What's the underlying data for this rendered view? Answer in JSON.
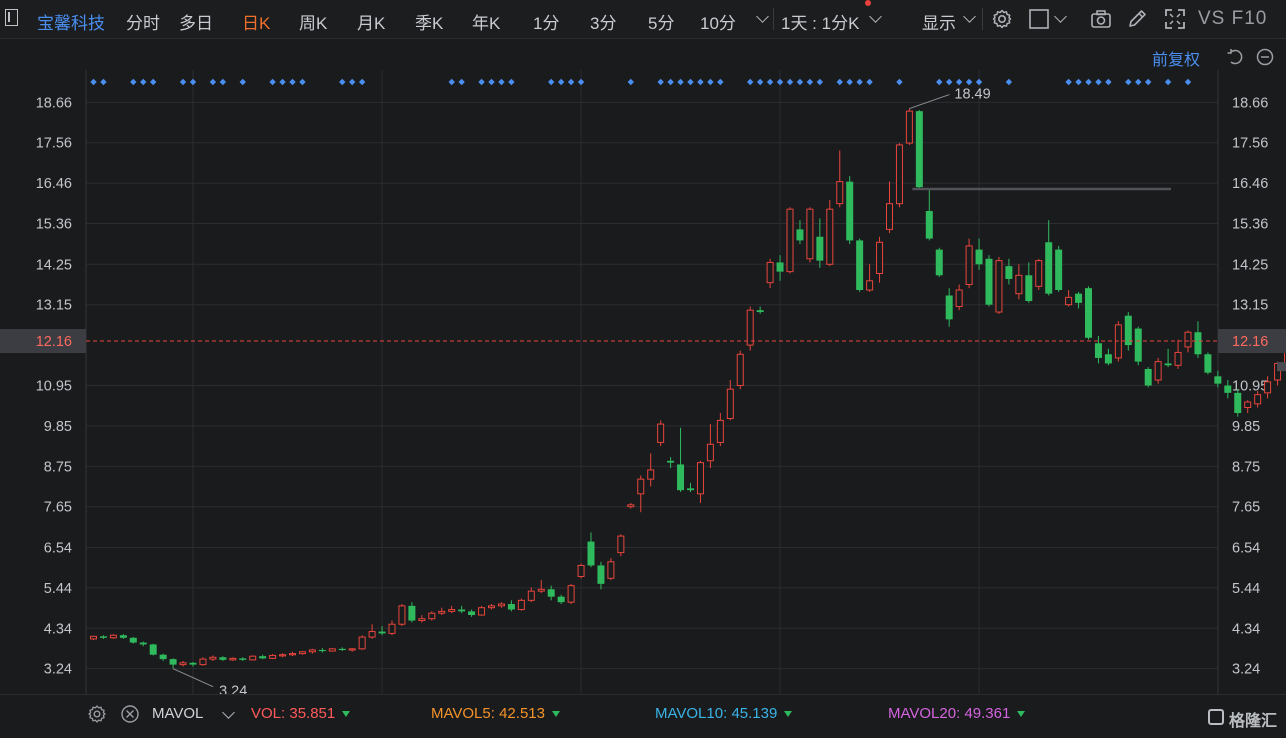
{
  "toolbar": {
    "stock_name": "宝馨科技",
    "periods": [
      {
        "label": "分时",
        "active": false
      },
      {
        "label": "多日",
        "active": false
      },
      {
        "label": "日K",
        "active": true
      },
      {
        "label": "周K",
        "active": false
      },
      {
        "label": "月K",
        "active": false
      },
      {
        "label": "季K",
        "active": false
      },
      {
        "label": "年K",
        "active": false
      },
      {
        "label": "1分",
        "active": false
      },
      {
        "label": "3分",
        "active": false
      },
      {
        "label": "5分",
        "active": false
      },
      {
        "label": "10分",
        "active": false
      }
    ],
    "multi_period": "1天 : 1分K",
    "display": "显示",
    "vs_f10": "VS F10"
  },
  "adjust": "前复权",
  "colors": {
    "up": "#e8453c",
    "down": "#2fba5d",
    "accent": "#f0702c",
    "link": "#4a8ff0",
    "grid": "#2c2d31",
    "marker": "#4a8ff0"
  },
  "chart_data": {
    "type": "candlestick",
    "y_ticks": [
      "18.66",
      "17.56",
      "16.46",
      "15.36",
      "14.25",
      "13.15",
      "12.16",
      "10.95",
      "9.85",
      "8.75",
      "7.65",
      "6.54",
      "5.44",
      "4.34",
      "3.24"
    ],
    "ylim": [
      2.55,
      19.54
    ],
    "current_price": "12.16",
    "high_label": "18.49",
    "low_label": "3.24",
    "resistance_level": 16.3,
    "candles": [
      [
        4.05,
        4.12,
        4.02,
        4.13
      ],
      [
        4.12,
        4.08,
        4.05,
        4.15
      ],
      [
        4.08,
        4.15,
        4.05,
        4.18
      ],
      [
        4.15,
        4.08,
        4.05,
        4.18
      ],
      [
        4.08,
        3.95,
        3.92,
        4.1
      ],
      [
        3.95,
        3.9,
        3.85,
        3.98
      ],
      [
        3.9,
        3.62,
        3.6,
        3.92
      ],
      [
        3.62,
        3.5,
        3.45,
        3.65
      ],
      [
        3.5,
        3.35,
        3.24,
        3.52
      ],
      [
        3.35,
        3.4,
        3.3,
        3.45
      ],
      [
        3.4,
        3.35,
        3.3,
        3.42
      ],
      [
        3.35,
        3.5,
        3.32,
        3.55
      ],
      [
        3.5,
        3.55,
        3.45,
        3.6
      ],
      [
        3.55,
        3.48,
        3.45,
        3.58
      ],
      [
        3.48,
        3.52,
        3.45,
        3.55
      ],
      [
        3.52,
        3.48,
        3.45,
        3.55
      ],
      [
        3.48,
        3.58,
        3.46,
        3.6
      ],
      [
        3.58,
        3.52,
        3.5,
        3.62
      ],
      [
        3.52,
        3.6,
        3.5,
        3.64
      ],
      [
        3.6,
        3.62,
        3.55,
        3.66
      ],
      [
        3.62,
        3.65,
        3.58,
        3.7
      ],
      [
        3.65,
        3.7,
        3.62,
        3.72
      ],
      [
        3.7,
        3.75,
        3.65,
        3.78
      ],
      [
        3.75,
        3.72,
        3.68,
        3.8
      ],
      [
        3.72,
        3.78,
        3.7,
        3.8
      ],
      [
        3.78,
        3.75,
        3.72,
        3.82
      ],
      [
        3.75,
        3.78,
        3.7,
        3.8
      ],
      [
        3.78,
        4.1,
        3.75,
        4.15
      ],
      [
        4.1,
        4.25,
        4.05,
        4.45
      ],
      [
        4.25,
        4.2,
        4.15,
        4.4
      ],
      [
        4.2,
        4.45,
        4.15,
        4.55
      ],
      [
        4.45,
        4.95,
        4.4,
        5.0
      ],
      [
        4.95,
        4.55,
        4.5,
        5.05
      ],
      [
        4.55,
        4.6,
        4.5,
        4.7
      ],
      [
        4.6,
        4.75,
        4.55,
        4.8
      ],
      [
        4.75,
        4.8,
        4.7,
        4.9
      ],
      [
        4.8,
        4.85,
        4.75,
        4.95
      ],
      [
        4.85,
        4.8,
        4.75,
        4.95
      ],
      [
        4.8,
        4.7,
        4.65,
        4.85
      ],
      [
        4.7,
        4.9,
        4.68,
        4.95
      ],
      [
        4.9,
        4.95,
        4.85,
        5.0
      ],
      [
        4.95,
        5.0,
        4.9,
        5.05
      ],
      [
        5.0,
        4.85,
        4.8,
        5.1
      ],
      [
        4.85,
        5.1,
        4.82,
        5.15
      ],
      [
        5.1,
        5.35,
        5.05,
        5.45
      ],
      [
        5.35,
        5.4,
        5.3,
        5.65
      ],
      [
        5.4,
        5.2,
        5.1,
        5.5
      ],
      [
        5.2,
        5.05,
        5.0,
        5.25
      ],
      [
        5.05,
        5.5,
        5.0,
        5.55
      ],
      [
        5.75,
        6.05,
        5.7,
        6.1
      ],
      [
        6.7,
        6.05,
        6.0,
        6.95
      ],
      [
        6.05,
        5.55,
        5.4,
        6.15
      ],
      [
        5.7,
        6.15,
        5.65,
        6.25
      ],
      [
        6.4,
        6.85,
        6.3,
        6.9
      ],
      [
        7.65,
        7.7,
        7.6,
        7.75
      ],
      [
        8.0,
        8.4,
        7.5,
        8.5
      ],
      [
        8.4,
        8.65,
        8.2,
        9.1
      ],
      [
        9.4,
        9.9,
        9.3,
        10.0
      ],
      [
        8.9,
        8.85,
        8.7,
        9.0
      ],
      [
        8.8,
        8.1,
        8.05,
        9.8
      ],
      [
        8.15,
        8.1,
        8.05,
        8.3
      ],
      [
        8.0,
        8.85,
        7.75,
        8.9
      ],
      [
        8.9,
        9.35,
        8.7,
        9.9
      ],
      [
        9.4,
        10.0,
        9.3,
        10.2
      ],
      [
        10.05,
        10.85,
        10.0,
        11.1
      ],
      [
        10.95,
        11.8,
        10.85,
        11.9
      ],
      [
        12.05,
        13.0,
        11.9,
        13.1
      ],
      [
        13.0,
        12.95,
        12.9,
        13.1
      ],
      [
        13.75,
        14.3,
        13.6,
        14.4
      ],
      [
        14.3,
        14.05,
        13.8,
        14.5
      ],
      [
        14.05,
        15.75,
        14.0,
        15.8
      ],
      [
        15.2,
        14.9,
        14.8,
        15.45
      ],
      [
        14.4,
        15.75,
        14.3,
        15.8
      ],
      [
        15.0,
        14.35,
        14.15,
        15.5
      ],
      [
        14.25,
        15.75,
        14.2,
        16.0
      ],
      [
        15.9,
        16.5,
        15.8,
        17.35
      ],
      [
        16.5,
        14.9,
        14.8,
        16.65
      ],
      [
        14.9,
        13.55,
        13.5,
        14.95
      ],
      [
        13.55,
        13.8,
        13.5,
        14.25
      ],
      [
        14.0,
        14.85,
        13.75,
        15.0
      ],
      [
        15.2,
        15.9,
        15.1,
        16.5
      ],
      [
        15.9,
        17.5,
        15.8,
        17.55
      ],
      [
        17.55,
        18.42,
        17.5,
        18.49
      ],
      [
        18.42,
        16.35,
        16.3,
        18.45
      ],
      [
        15.7,
        14.95,
        14.9,
        16.3
      ],
      [
        14.65,
        13.95,
        13.9,
        14.7
      ],
      [
        13.4,
        12.75,
        12.55,
        13.6
      ],
      [
        13.1,
        13.55,
        13.0,
        13.7
      ],
      [
        13.7,
        14.75,
        13.6,
        14.95
      ],
      [
        14.65,
        14.25,
        14.1,
        14.95
      ],
      [
        14.4,
        13.15,
        13.1,
        14.5
      ],
      [
        12.95,
        14.35,
        12.9,
        14.45
      ],
      [
        14.2,
        13.85,
        13.7,
        14.4
      ],
      [
        13.45,
        13.95,
        13.3,
        14.25
      ],
      [
        13.95,
        13.25,
        13.2,
        14.3
      ],
      [
        13.65,
        14.35,
        13.55,
        14.4
      ],
      [
        14.85,
        13.45,
        13.4,
        15.45
      ],
      [
        14.65,
        13.55,
        13.5,
        14.75
      ],
      [
        13.15,
        13.35,
        13.1,
        13.55
      ],
      [
        13.45,
        13.2,
        13.05,
        13.5
      ],
      [
        13.6,
        12.25,
        12.2,
        13.65
      ],
      [
        12.1,
        11.7,
        11.55,
        12.3
      ],
      [
        11.8,
        11.55,
        11.5,
        11.95
      ],
      [
        11.7,
        12.6,
        11.6,
        12.7
      ],
      [
        12.85,
        12.05,
        11.9,
        12.95
      ],
      [
        12.5,
        11.6,
        11.5,
        12.55
      ],
      [
        11.4,
        10.95,
        10.9,
        11.45
      ],
      [
        11.1,
        11.6,
        11.0,
        11.7
      ],
      [
        11.55,
        11.5,
        11.45,
        11.95
      ],
      [
        11.5,
        11.85,
        11.4,
        12.2
      ],
      [
        12.0,
        12.4,
        11.85,
        12.45
      ],
      [
        12.4,
        11.8,
        11.7,
        12.7
      ],
      [
        11.8,
        11.3,
        11.25,
        11.85
      ],
      [
        11.2,
        11.0,
        10.9,
        11.35
      ],
      [
        10.95,
        10.75,
        10.6,
        11.1
      ],
      [
        10.75,
        10.2,
        10.1,
        10.85
      ],
      [
        10.35,
        10.5,
        10.2,
        10.55
      ],
      [
        10.45,
        10.7,
        10.35,
        10.8
      ],
      [
        10.75,
        11.05,
        10.6,
        11.2
      ],
      [
        11.1,
        11.55,
        10.95,
        11.6
      ],
      [
        11.55,
        12.15,
        11.45,
        12.2
      ]
    ],
    "markers": [
      0,
      1,
      4,
      5,
      6,
      9,
      10,
      12,
      13,
      15,
      18,
      19,
      20,
      21,
      25,
      26,
      27,
      36,
      37,
      39,
      40,
      41,
      42,
      46,
      47,
      48,
      49,
      54,
      57,
      58,
      59,
      60,
      61,
      62,
      63,
      66,
      67,
      68,
      69,
      70,
      71,
      72,
      73,
      75,
      76,
      77,
      78,
      81,
      85,
      86,
      87,
      88,
      89,
      92,
      98,
      99,
      100,
      101,
      102,
      104,
      105,
      106,
      108,
      110
    ],
    "vertical_grid_at": [
      10,
      29,
      49,
      69,
      89
    ]
  },
  "indicator": {
    "name": "MAVOL",
    "values": [
      {
        "label": "VOL:",
        "value": "35.851",
        "color": "#ff5a5a"
      },
      {
        "label": "MAVOL5:",
        "value": "42.513",
        "color": "#f5932a"
      },
      {
        "label": "MAVOL10:",
        "value": "45.139",
        "color": "#3ab4e8"
      },
      {
        "label": "MAVOL20:",
        "value": "49.361",
        "color": "#d564e0"
      }
    ]
  },
  "logo": "格隆汇"
}
